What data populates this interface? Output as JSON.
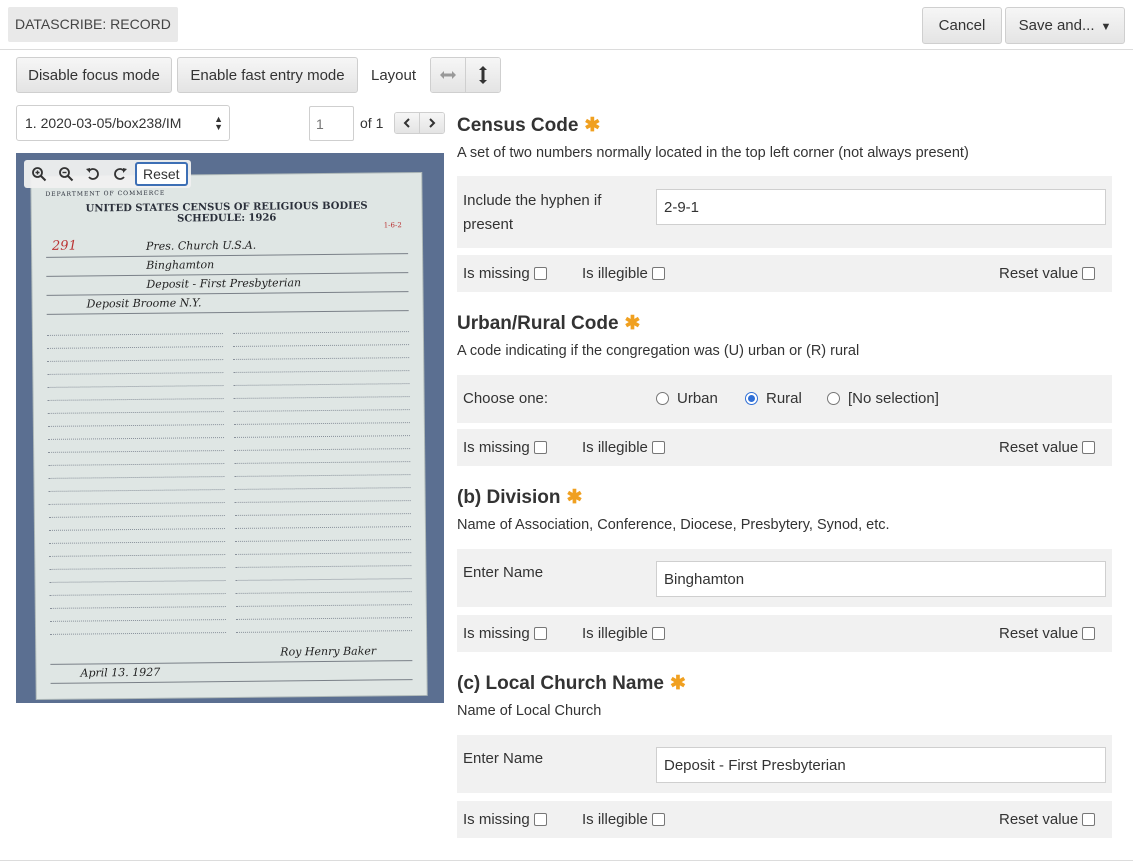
{
  "header": {
    "app_title": "DATASCRIBE: RECORD",
    "cancel_label": "Cancel",
    "save_label": "Save and..."
  },
  "toolbar": {
    "focus_label": "Disable focus mode",
    "fast_entry_label": "Enable fast entry mode",
    "layout_label": "Layout",
    "layout_horizontal_icon": "arrows-horizontal-icon",
    "layout_vertical_icon": "arrows-vertical-icon"
  },
  "pager": {
    "selected_page": "1. 2020-03-05/box238/IM",
    "page_number_placeholder": "1",
    "of_label": "of 1"
  },
  "viewer": {
    "reset_label": "Reset",
    "document": {
      "dept": "DEPARTMENT OF COMMERCE",
      "title": "UNITED STATES CENSUS OF RELIGIOUS BODIES",
      "schedule": "SCHEDULE: 1926",
      "code_stamp": "1-6-2",
      "number": "291",
      "denomination": "Pres. Church U.S.A.",
      "presbytery": "Binghamton",
      "church_name": "Deposit - First Presbyterian",
      "city": "Deposit   Broome   N.Y.",
      "signature": "Roy Henry Baker",
      "date": "April 13. 1927"
    }
  },
  "sections": [
    {
      "title": "Census Code",
      "description": "A set of two numbers normally located in the top left corner (not always present)",
      "label": "Include the hyphen if present",
      "value": "2-9-1"
    },
    {
      "title": "Urban/Rural Code",
      "description": "A code indicating if the congregation was (U) urban or (R) rural",
      "label": "Choose one:",
      "options": [
        "Urban",
        "Rural",
        "[No selection]"
      ],
      "selected": "Rural"
    },
    {
      "title": "(b) Division",
      "description": "Name of Association, Conference, Diocese, Presbytery, Synod, etc.",
      "label": "Enter Name",
      "value": "Binghamton"
    },
    {
      "title": "(c) Local Church Name",
      "description": "Name of Local Church",
      "label": "Enter Name",
      "value": "Deposit - First Presbyterian"
    }
  ],
  "checks": {
    "missing_label": "Is missing",
    "illegible_label": "Is illegible",
    "reset_label": "Reset value"
  },
  "required_mark": "✱"
}
